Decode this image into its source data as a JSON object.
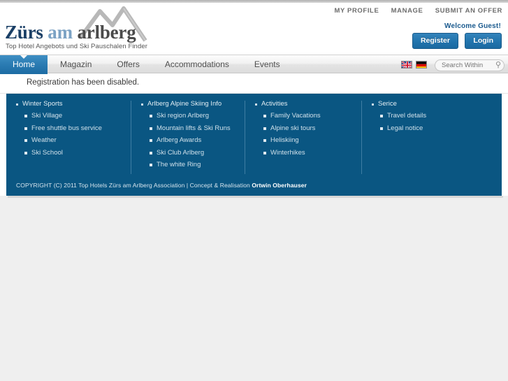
{
  "header": {
    "logo": {
      "word1": "Zürs",
      "word2": "am",
      "word3": "arlberg",
      "tagline": "Top Hotel Angebots und Ski Pauschalen Finder"
    },
    "top_links": [
      {
        "label": "MY PROFILE"
      },
      {
        "label": "MANAGE"
      },
      {
        "label": "SUBMIT AN OFFER"
      }
    ],
    "welcome": "Welcome Guest!",
    "register_label": "Register",
    "login_label": "Login"
  },
  "nav": {
    "items": [
      {
        "label": "Home",
        "active": true
      },
      {
        "label": "Magazin",
        "active": false
      },
      {
        "label": "Offers",
        "active": false
      },
      {
        "label": "Accommodations",
        "active": false
      },
      {
        "label": "Events",
        "active": false
      }
    ],
    "flags": [
      {
        "name": "flag-en",
        "title": "English"
      },
      {
        "name": "flag-de",
        "title": "Deutsch"
      }
    ],
    "search": {
      "placeholder": "Search Within",
      "value": "",
      "icon": "search-icon"
    }
  },
  "content": {
    "notice": "Registration has been disabled."
  },
  "footer": {
    "columns": [
      {
        "heading": "Winter Sports",
        "links": [
          "Ski Village",
          "Free shuttle bus service",
          "Weather",
          "Ski School"
        ]
      },
      {
        "heading": "Arlberg Alpine Skiing Info",
        "links": [
          "Ski region Arlberg",
          "Mountain lifts & Ski Runs",
          "Arlberg Awards",
          "Ski Club Arlberg",
          "The white Ring"
        ]
      },
      {
        "heading": "Activities",
        "links": [
          "Family Vacations",
          "Alpine ski tours",
          "Heliskiing",
          "Winterhikes"
        ]
      },
      {
        "heading": "Serice",
        "links": [
          "Travel details",
          "Legal notice"
        ]
      }
    ],
    "copyright_text": "COPYRIGHT (C) 2011 Top Hotels Zürs am Arlberg Association | Concept & Realisation ",
    "copyright_author": "Ortwin Oberhauser"
  },
  "colors": {
    "brand_blue": "#0a5682",
    "nav_active": "#2a7bb2",
    "button_blue": "#2275ae",
    "page_bg": "#efefef"
  }
}
